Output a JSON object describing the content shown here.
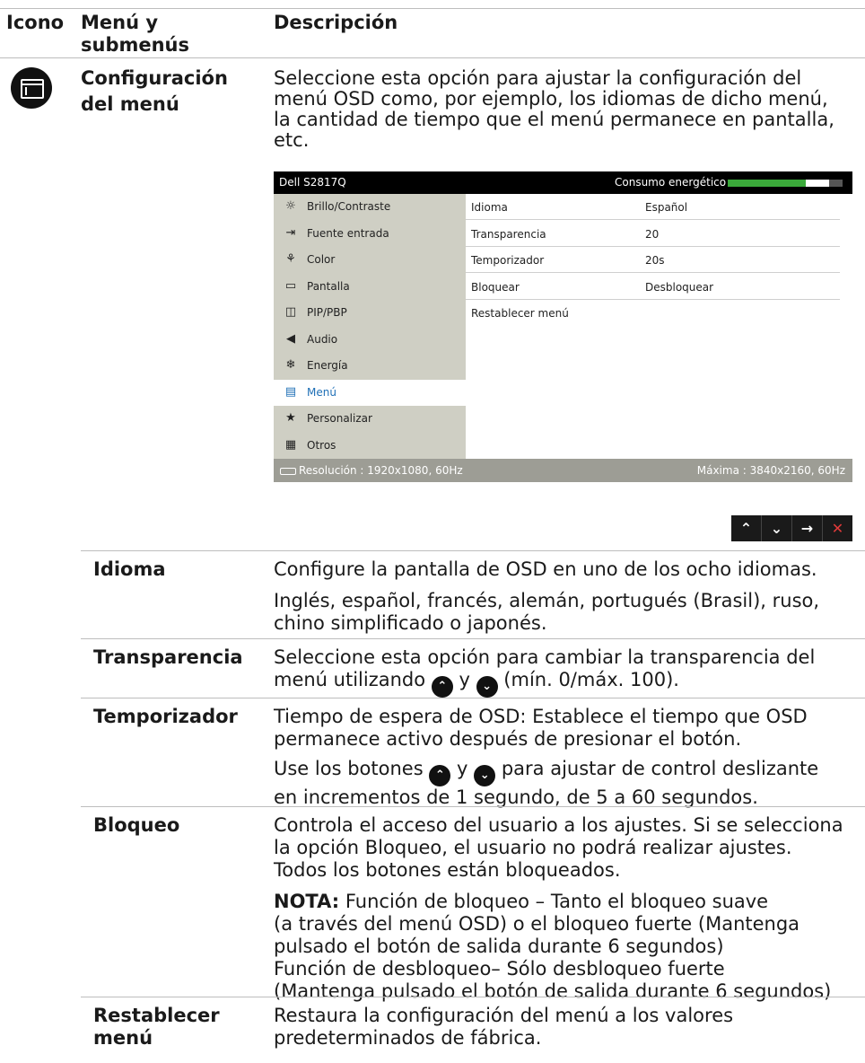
{
  "header": {
    "col_icon": "Icono",
    "col_menu_line1": "Menú y",
    "col_menu_line2": "submenús",
    "col_desc": "Descripción"
  },
  "main": {
    "icon": "menu-config-icon",
    "title_line1": "Configuración",
    "title_line2": "del menú",
    "desc_l1": "Seleccione esta opción para ajustar la configuración del",
    "desc_l2": "menú OSD como, por ejemplo, los idiomas de dicho menú,",
    "desc_l3": "la cantidad de tiempo que el menú permanece en pantalla,",
    "desc_l4": "etc."
  },
  "osd": {
    "model": "Dell S2817Q",
    "power_label": "Consumo energético",
    "power_level": 0.68,
    "menu": [
      {
        "label": "Brillo/Contraste",
        "icon": "brightness-icon"
      },
      {
        "label": "Fuente entrada",
        "icon": "input-source-icon"
      },
      {
        "label": "Color",
        "icon": "color-icon"
      },
      {
        "label": "Pantalla",
        "icon": "display-icon"
      },
      {
        "label": "PIP/PBP",
        "icon": "pip-icon"
      },
      {
        "label": "Audio",
        "icon": "audio-icon"
      },
      {
        "label": "Energía",
        "icon": "energy-icon"
      },
      {
        "label": "Menú",
        "icon": "menu-icon"
      },
      {
        "label": "Personalizar",
        "icon": "star-icon"
      },
      {
        "label": "Otros",
        "icon": "others-icon"
      }
    ],
    "active_menu": "Menú",
    "settings": [
      {
        "key": "Idioma",
        "value": "Español"
      },
      {
        "key": "Transparencia",
        "value": "20"
      },
      {
        "key": "Temporizador",
        "value": "20s"
      },
      {
        "key": "Bloquear",
        "value": "Desbloquear"
      },
      {
        "key": "Restablecer menú",
        "value": ""
      }
    ],
    "resolution": "Resolución : 1920x1080, 60Hz",
    "max": "Máxima : 3840x2160, 60Hz"
  },
  "buttons": [
    "up-icon",
    "down-icon",
    "right-arrow-icon",
    "close-icon"
  ],
  "rows": {
    "idioma": {
      "label": "Idioma",
      "l1": "Configure la pantalla de OSD en uno de los ocho idiomas.",
      "l2": "Inglés, español, francés, alemán, portugués (Brasil), ruso,",
      "l3": "chino simplificado o japonés."
    },
    "transparencia": {
      "label": "Transparencia",
      "l1": "Seleccione esta opción para cambiar la transparencia del",
      "l2a": "menú utilizando",
      "l2b": "y",
      "l2c": "(mín. 0/máx. 100)."
    },
    "temporizador": {
      "label": "Temporizador",
      "l1": "Tiempo de espera de OSD: Establece el tiempo que OSD",
      "l2": "permanece activo después de presionar el botón.",
      "l3a": "Use los botones",
      "l3b": "y",
      "l3c": "para ajustar de control deslizante",
      "l4": "en incrementos de 1 segundo, de 5 a 60 segundos."
    },
    "bloqueo": {
      "label": "Bloqueo",
      "l1": "Controla el acceso del usuario a los ajustes. Si se selecciona",
      "l2": "la opción Bloqueo, el usuario no podrá realizar ajustes.",
      "l3": "Todos los botones están bloqueados.",
      "note_label": "NOTA:",
      "n1": "Función de bloqueo – Tanto el bloqueo suave",
      "n2": "(a través del menú OSD) o el bloqueo fuerte (Mantenga",
      "n3": "pulsado el botón de salida durante 6 segundos)",
      "n4": "Función de desbloqueo– Sólo desbloqueo fuerte",
      "n5": "(Mantenga pulsado el botón de salida durante 6 segundos)"
    },
    "restablecer": {
      "label_l1": "Restablecer",
      "label_l2": "menú",
      "l1": "Restaura la configuración del menú a los valores",
      "l2": "predeterminados de fábrica."
    }
  }
}
